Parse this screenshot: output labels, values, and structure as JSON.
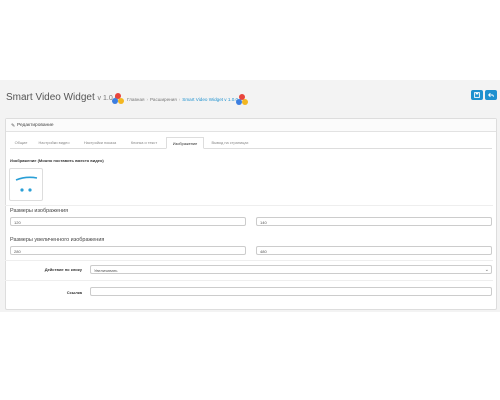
{
  "header": {
    "title": "Smart Video Widget",
    "version": "v 1.0.0",
    "breadcrumb": [
      "Главная",
      "Расширения",
      "Smart Video Widget v 1.0.0"
    ]
  },
  "buttons": {
    "save_icon": "save-icon",
    "back_icon": "reply-icon"
  },
  "panel": {
    "title": "Редактирование"
  },
  "tabs": [
    "Общие",
    "Настройки видео",
    "Настройки показа",
    "Кнопка и текст",
    "Изображение",
    "Вывод на страницах"
  ],
  "image_section": {
    "label": "Изображение (Можно поставить вместо видео)"
  },
  "sizes": {
    "label": "Размеры изображения",
    "width": "120",
    "height": "140"
  },
  "zoom_sizes": {
    "label": "Размеры увеличенного изображения",
    "width": "280",
    "height": "480"
  },
  "click_action": {
    "label": "Действие по клику",
    "value": "Увеличивать"
  },
  "link": {
    "label": "Ссылка",
    "value": ""
  },
  "colors": {
    "accent": "#1e91cf",
    "logo_red": "#e8453c",
    "logo_blue": "#3d7ee0",
    "logo_yellow": "#f3b721"
  }
}
